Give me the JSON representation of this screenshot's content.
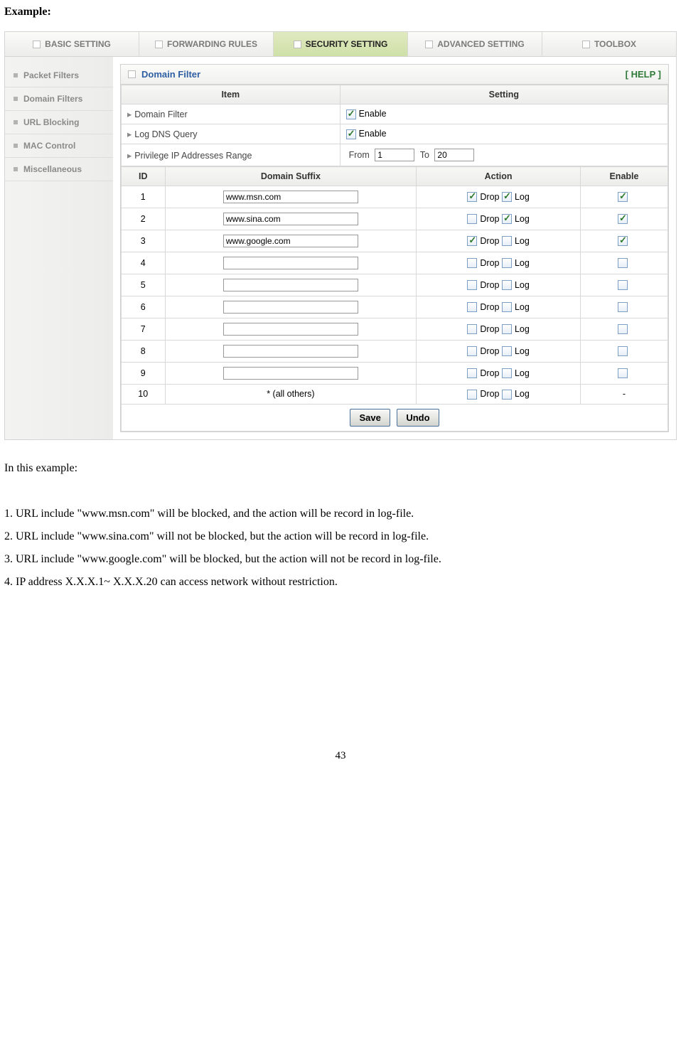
{
  "doc": {
    "heading": "Example:",
    "intro": "In this example:",
    "points": {
      "p1": "1. URL include \"www.msn.com\" will be blocked, and the action will be record in log-file.",
      "p2": "2. URL include \"www.sina.com\" will not be blocked, but the action will be record in log-file.",
      "p3": "3. URL include \"www.google.com\" will be blocked, but the action will not be record in log-file.",
      "p4": "4. IP address X.X.X.1~ X.X.X.20 can access network without restriction."
    },
    "page_number": "43"
  },
  "tabs": {
    "t0": "BASIC SETTING",
    "t1": "FORWARDING RULES",
    "t2": "SECURITY SETTING",
    "t3": "ADVANCED SETTING",
    "t4": "TOOLBOX"
  },
  "sidebar": {
    "s0": "Packet Filters",
    "s1": "Domain Filters",
    "s2": "URL Blocking",
    "s3": "MAC Control",
    "s4": "Miscellaneous"
  },
  "panel": {
    "title": "Domain Filter",
    "help": "[ HELP ]"
  },
  "headers": {
    "item": "Item",
    "setting": "Setting",
    "id": "ID",
    "domain_suffix": "Domain Suffix",
    "action": "Action",
    "enable": "Enable"
  },
  "settings": {
    "domain_filter_label": "Domain Filter",
    "log_dns_label": "Log DNS Query",
    "privilege_label": "Privilege IP Addresses Range",
    "enable_label": "Enable",
    "from_label": "From",
    "to_label": "To",
    "from_value": "1",
    "to_value": "20"
  },
  "actions": {
    "drop": "Drop",
    "log": "Log"
  },
  "rows": {
    "r1": {
      "id": "1",
      "domain": "www.msn.com",
      "drop": true,
      "log": true,
      "enable": true
    },
    "r2": {
      "id": "2",
      "domain": "www.sina.com",
      "drop": false,
      "log": true,
      "enable": true
    },
    "r3": {
      "id": "3",
      "domain": "www.google.com",
      "drop": true,
      "log": false,
      "enable": true
    },
    "r4": {
      "id": "4",
      "domain": "",
      "drop": false,
      "log": false,
      "enable": false
    },
    "r5": {
      "id": "5",
      "domain": "",
      "drop": false,
      "log": false,
      "enable": false
    },
    "r6": {
      "id": "6",
      "domain": "",
      "drop": false,
      "log": false,
      "enable": false
    },
    "r7": {
      "id": "7",
      "domain": "",
      "drop": false,
      "log": false,
      "enable": false
    },
    "r8": {
      "id": "8",
      "domain": "",
      "drop": false,
      "log": false,
      "enable": false
    },
    "r9": {
      "id": "9",
      "domain": "",
      "drop": false,
      "log": false,
      "enable": false
    },
    "r10": {
      "id": "10",
      "domain_label": "* (all others)",
      "drop": false,
      "log": false,
      "enable_label": "-"
    }
  },
  "buttons": {
    "save": "Save",
    "undo": "Undo"
  }
}
